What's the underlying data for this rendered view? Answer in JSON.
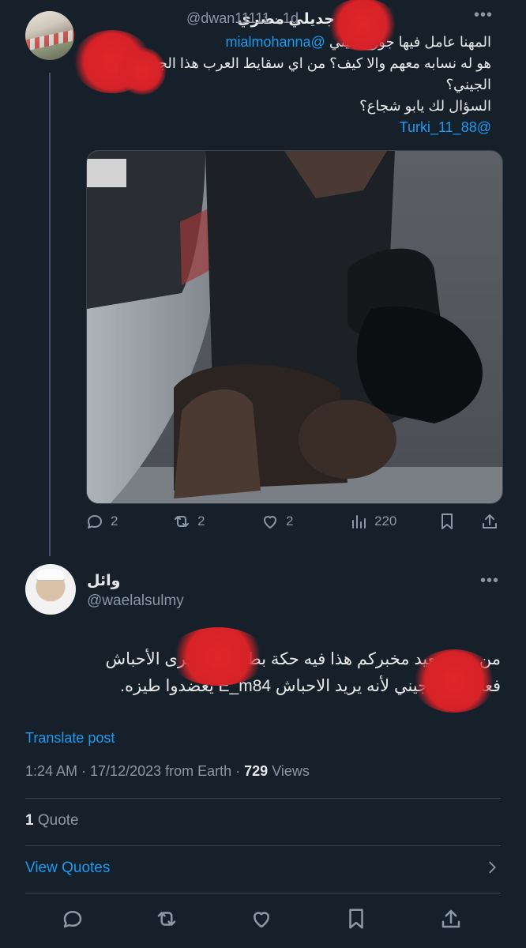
{
  "tweet1": {
    "display_name": "جديلي مضري",
    "handle_time": "@dwan11111 · 1d",
    "line1_prefix": "المهنا عامل ",
    "line1_obscured": "فيها جورج",
    "line1_mid": " جيني ",
    "line1_mention": "@mialmohanna",
    "line2": "هو له نسابه معهم والا كيف؟ من اي سقايط العرب هذا الجورج",
    "line3": "الجيني؟",
    "line4": "السؤال لك يابو شجاع؟",
    "reply_mention": "@Turki_11_88",
    "actions": {
      "replies": "2",
      "reposts": "2",
      "likes": "2",
      "views": "220"
    }
  },
  "tweet2": {
    "display_name": "وائل",
    "handle": "@waelalsulmy",
    "line1": "من زمن بعيد مخبركم هذا فيه حكة بطيز عندنا يرى الأحباش",
    "line2": "فعلا جورج جيني لأنه يريد الاحباش E_m84 يعضدوا طيزه.",
    "translate": "Translate post",
    "time_date": "1:24 AM · 17/12/2023 from Earth · ",
    "views_count": "729",
    "views_label": " Views",
    "quote_count": "1",
    "quote_label": " Quote",
    "view_quotes": "View Quotes"
  },
  "colors": {
    "background": "#15202b",
    "accent": "#1d9bf0",
    "muted": "#8b98a5",
    "redaction": "#d62228"
  },
  "icons": [
    "reply-icon",
    "repost-icon",
    "like-icon",
    "views-icon",
    "bookmark-icon",
    "share-icon",
    "more-icon",
    "chevron-right-icon"
  ]
}
